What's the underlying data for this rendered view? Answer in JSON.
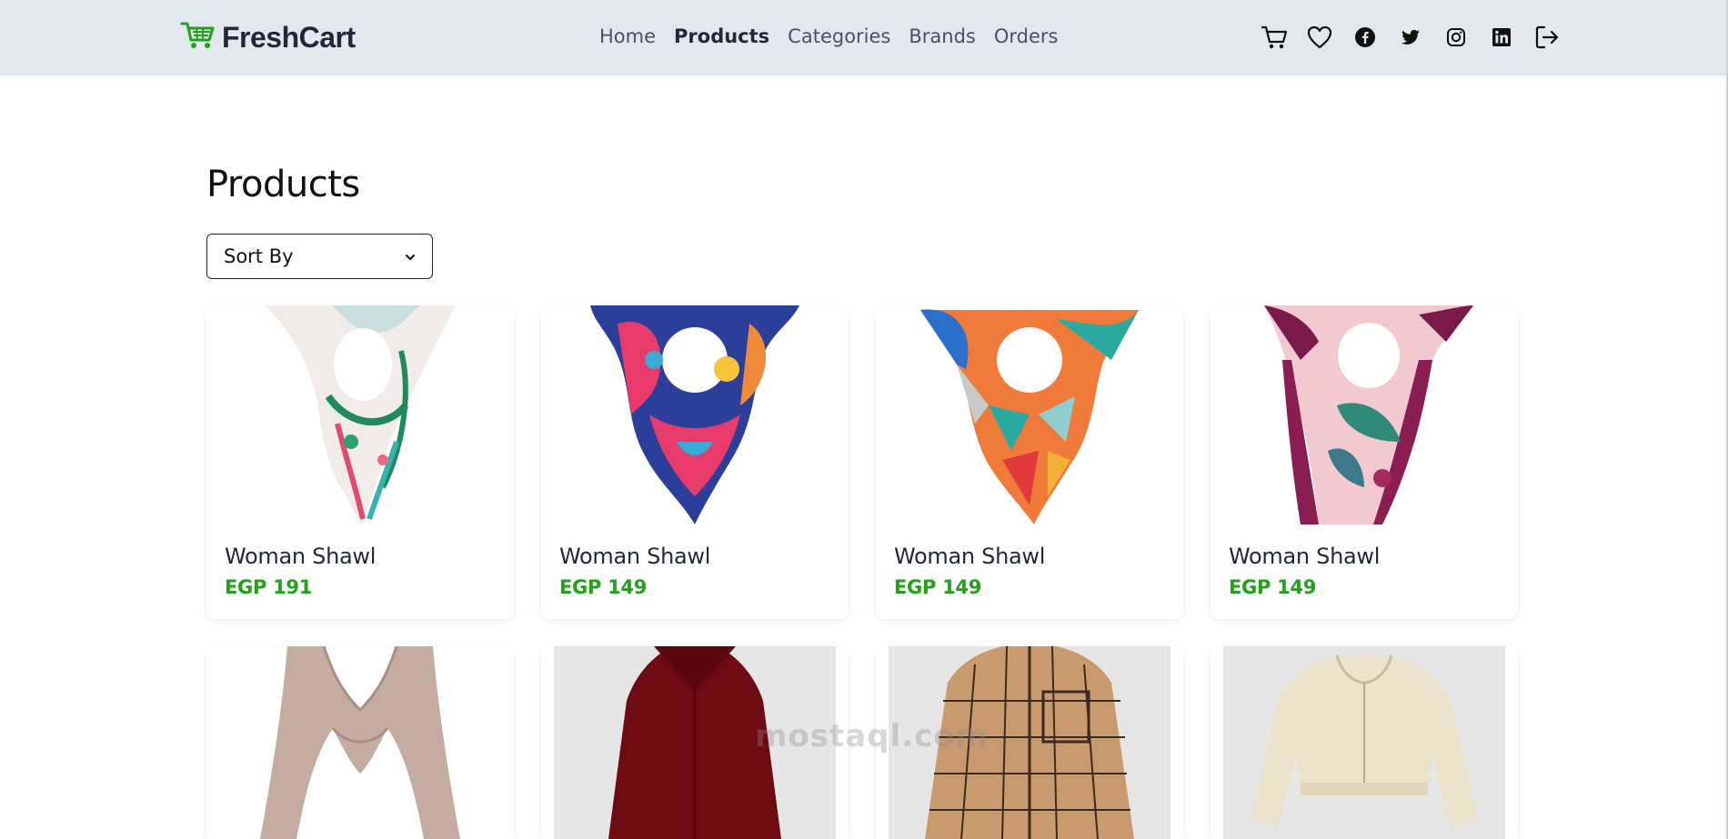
{
  "header": {
    "brand_name": "FreshCart",
    "nav_links": [
      "Home",
      "Products",
      "Categories",
      "Brands",
      "Orders"
    ],
    "active_link": "Products",
    "icons": [
      "cart-icon",
      "heart-icon",
      "facebook-icon",
      "twitter-icon",
      "instagram-icon",
      "linkedin-icon",
      "logout-icon"
    ]
  },
  "main": {
    "title": "Products",
    "sort": {
      "selected": "Sort By"
    }
  },
  "products": [
    {
      "title": "Woman Shawl",
      "price": "EGP 191"
    },
    {
      "title": "Woman Shawl",
      "price": "EGP 149"
    },
    {
      "title": "Woman Shawl",
      "price": "EGP 149"
    },
    {
      "title": "Woman Shawl",
      "price": "EGP 149"
    },
    {
      "title": "",
      "price": ""
    },
    {
      "title": "",
      "price": ""
    },
    {
      "title": "",
      "price": ""
    },
    {
      "title": "",
      "price": ""
    }
  ],
  "watermark": {
    "text": "mostaql.com"
  },
  "colors": {
    "navbar_bg": "#e3e8ef",
    "brand_green": "#22a11a",
    "price_green": "#22a11a",
    "text_dark": "#1f2937"
  }
}
